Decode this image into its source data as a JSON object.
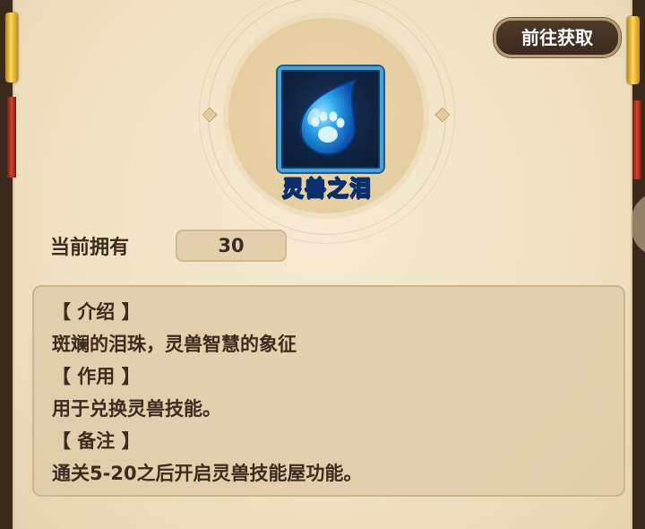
{
  "header": {
    "get_button_label": "前往获取"
  },
  "item": {
    "name": "灵兽之泪",
    "icon": "blue-paw-teardrop-icon"
  },
  "ownership": {
    "label": "当前拥有",
    "count": "30"
  },
  "description": {
    "intro_heading": "【 介绍 】",
    "intro_text": "斑斓的泪珠，灵兽智慧的象征",
    "use_heading": "【 作用 】",
    "use_text": "用于兑换灵兽技能。",
    "note_heading": "【 备注 】",
    "note_text": "通关5-20之后开启灵兽技能屋功能。"
  },
  "colors": {
    "panel_bg": "#efe1c2",
    "item_name": "#2f8ff0",
    "button_bg": "#4f3a2c",
    "text": "#3c2b1e"
  }
}
